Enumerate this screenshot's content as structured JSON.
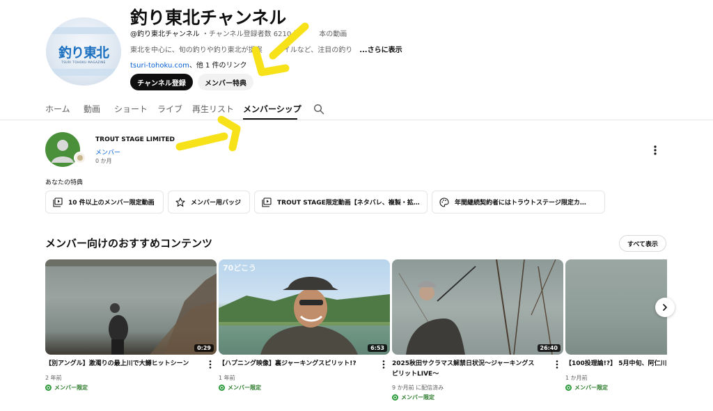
{
  "channel": {
    "name": "釣り東北チャンネル",
    "handle": "@釣り東北チャンネル",
    "meta_rest": " ・チャンネル登録者数 6210人・",
    "meta_tail": "本の動画",
    "description": "東北を中心に、旬の釣りや釣り東北が提案",
    "description_tail": "タイルなど、注目の釣り",
    "description_more": "...さらに表示",
    "link_url": "tsuri-tohoku.com",
    "link_others": "、他 1 件のリンク",
    "logo_text": "釣り東北",
    "logo_sub": "TSURI TOHOKU MAGAZINE"
  },
  "buttons": {
    "subscribe": "チャンネル登録",
    "perks": "メンバー特典",
    "show_all": "すべて表示"
  },
  "tabs": [
    {
      "label": "ホーム"
    },
    {
      "label": "動画"
    },
    {
      "label": "ショート"
    },
    {
      "label": "ライブ"
    },
    {
      "label": "再生リスト"
    },
    {
      "label": "メンバーシップ",
      "active": true
    }
  ],
  "membership": {
    "tier": "TROUT STAGE LIMITED",
    "role": "メンバー",
    "duration": "0 か月"
  },
  "perks": {
    "title": "あなたの特典",
    "items": [
      {
        "icon": "video-library-icon",
        "label": "10 件以上のメンバー限定動画"
      },
      {
        "icon": "star-icon",
        "label": "メンバー用バッジ"
      },
      {
        "icon": "video-library-icon",
        "label": "TROUT STAGE限定動画【ネタバレ、複製・拡…"
      },
      {
        "icon": "palette-icon",
        "label": "年間継続契約者にはトラウトステージ限定カ…"
      }
    ]
  },
  "recommended": {
    "title": "メンバー向けのおすすめコンテンツ",
    "videos": [
      {
        "title": "【別アングル】激濁りの最上川で大鱒ヒットシーン",
        "duration": "0:29",
        "meta": "2 年前",
        "badge": "メンバー限定"
      },
      {
        "title": "【ハプニング映像】裏ジャーキングスピリット!?",
        "duration": "6:53",
        "meta": "1 年前",
        "badge": "メンバー限定",
        "overlay": "70どこう"
      },
      {
        "title": "2025秋田サクラマス解禁日状況〜ジャーキングスピリットLIVE〜",
        "duration": "26:40",
        "meta": "9 か月前 に配信済み",
        "badge": "メンバー限定"
      },
      {
        "title": "【100投理論!?】 5月中旬、阿仁川",
        "meta": "1 か月前",
        "badge": "メンバー限定"
      }
    ]
  },
  "colors": {
    "link_blue": "#065fd4",
    "badge_green": "#2a7a2a",
    "annotation_yellow": "#f7e21a"
  }
}
